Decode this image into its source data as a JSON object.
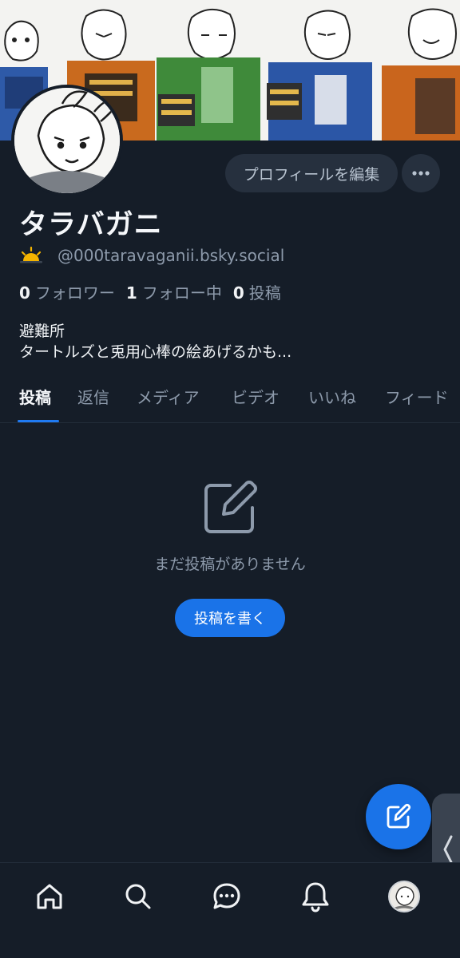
{
  "profile": {
    "display_name": "タラバガニ",
    "handle": "@000taravaganii.bsky.social",
    "status_icon": "sunrise-icon",
    "bio_line1": "避難所",
    "bio_line2": "タートルズと兎用心棒の絵あげるかも..."
  },
  "stats": {
    "followers_count": "0",
    "followers_label": "フォロワー",
    "following_count": "1",
    "following_label": "フォロー中",
    "posts_count": "0",
    "posts_label": "投稿"
  },
  "actions": {
    "edit_profile": "プロフィールを編集",
    "more": "more-icon"
  },
  "tabs": [
    {
      "label": "投稿",
      "active": true
    },
    {
      "label": "返信",
      "active": false
    },
    {
      "label": "メディア",
      "active": false
    },
    {
      "label": "ビデオ",
      "active": false
    },
    {
      "label": "いいね",
      "active": false
    },
    {
      "label": "フィード",
      "active": false
    }
  ],
  "empty_state": {
    "icon": "compose-icon",
    "message": "まだ投稿がありません",
    "button": "投稿を書く"
  },
  "bottom_nav": [
    {
      "name": "home",
      "icon": "home-icon"
    },
    {
      "name": "search",
      "icon": "search-icon"
    },
    {
      "name": "chat",
      "icon": "chat-icon"
    },
    {
      "name": "notifications",
      "icon": "bell-icon"
    },
    {
      "name": "profile",
      "icon": "avatar"
    }
  ],
  "colors": {
    "background": "#151d28",
    "accent": "#1a73e8",
    "muted_text": "#8d9aab"
  }
}
